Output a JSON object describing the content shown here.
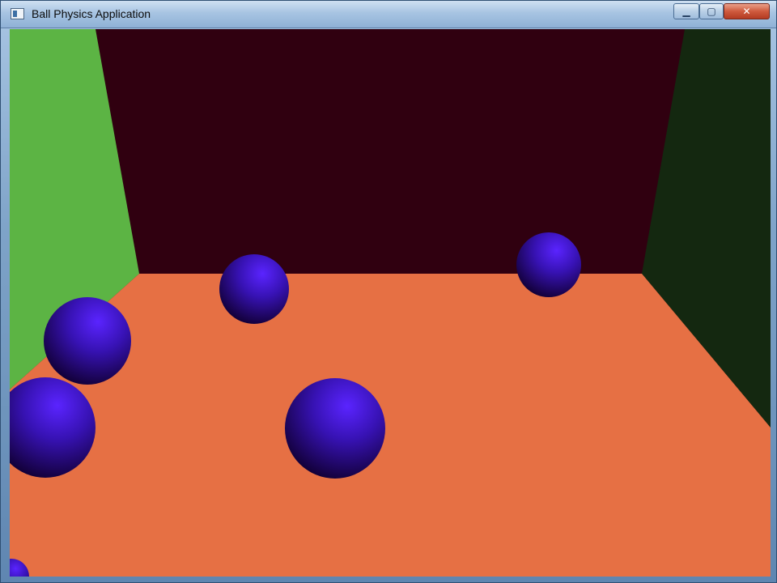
{
  "window": {
    "title": "Ball Physics Application",
    "icon": "window-app-icon",
    "controls": {
      "minimize": {
        "icon": "minimize-icon",
        "glyph": "▁"
      },
      "maximize": {
        "icon": "maximize-icon",
        "glyph": "▢"
      },
      "close": {
        "icon": "close-icon",
        "glyph": "✕"
      }
    }
  },
  "scene": {
    "colors": {
      "back_wall": "#300010",
      "left_wall": "#5cb444",
      "right_wall": "#142810",
      "floor": "#e67044",
      "ball_highlight": "#5a24ff",
      "ball_mid": "#3712b3",
      "ball_shadow": "#120038"
    },
    "balls_visible": 6
  }
}
